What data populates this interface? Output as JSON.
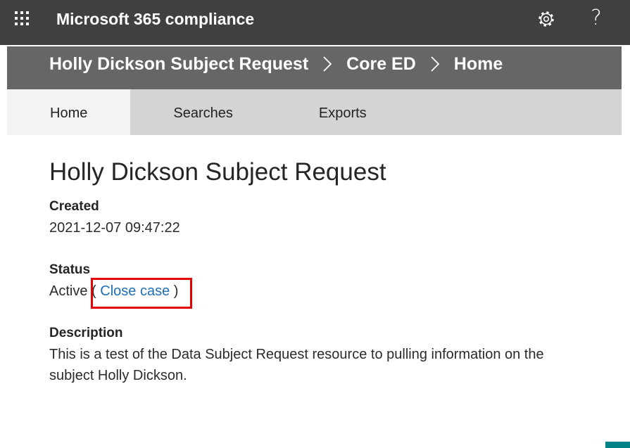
{
  "suite_header": {
    "title": "Microsoft 365 compliance",
    "help_glyph": "?",
    "icons": {
      "app_launcher": "waffle-icon",
      "settings": "gear-icon",
      "help": "question-icon"
    }
  },
  "breadcrumb": {
    "items": [
      "Holly Dickson Subject Request",
      "Core ED",
      "Home"
    ],
    "separator_icon": "chevron-right-icon"
  },
  "tabs": [
    {
      "label": "Home",
      "active": true
    },
    {
      "label": "Searches",
      "active": false
    },
    {
      "label": "Exports",
      "active": false
    }
  ],
  "case": {
    "title": "Holly Dickson Subject Request",
    "created": {
      "label": "Created",
      "value": "2021-12-07 09:47:22"
    },
    "status": {
      "label": "Status",
      "value": "Active",
      "open_paren": "(",
      "action_link": "Close case",
      "close_paren": ")"
    },
    "description": {
      "label": "Description",
      "value": "This is a test of the Data Subject Request resource to pulling information on the subject Holly Dickson."
    }
  },
  "colors": {
    "suite_header_bg": "#404040",
    "breadcrumb_bg": "#666666",
    "tab_bar_bg": "#d4d4d4",
    "active_tab_bg": "#f3f3f3",
    "link": "#1f6fb2",
    "highlight": "#e60000",
    "accent_teal": "#038387"
  }
}
